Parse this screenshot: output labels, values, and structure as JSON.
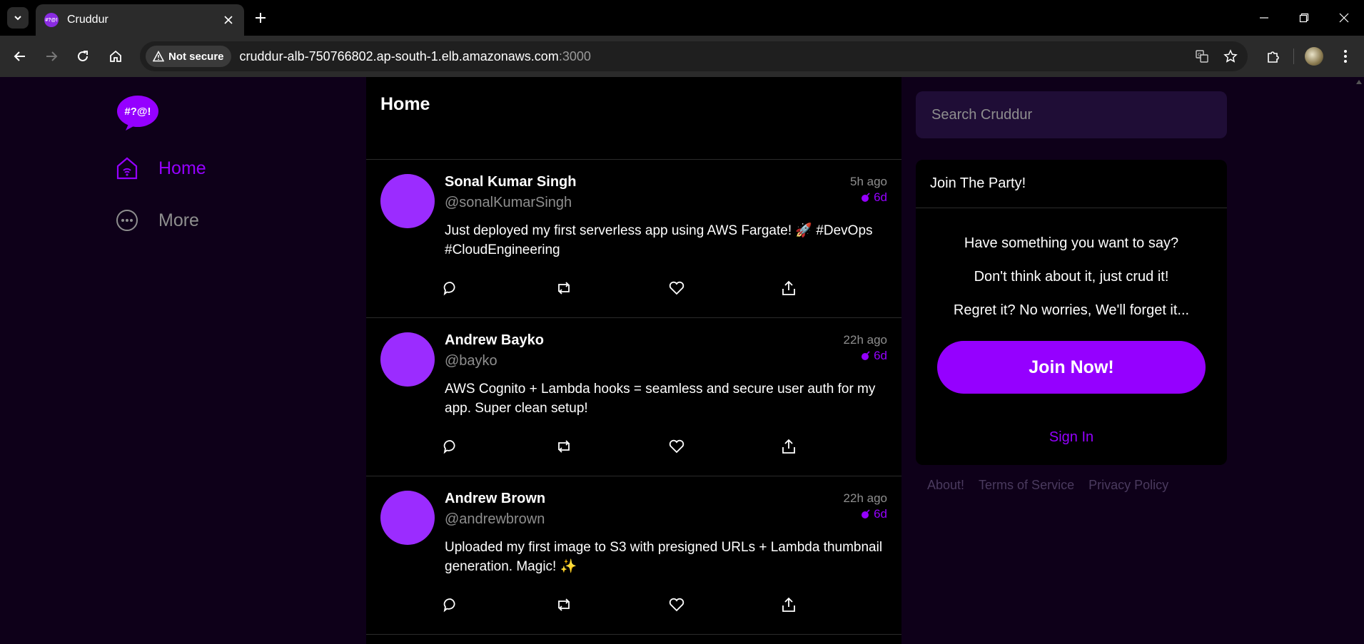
{
  "browser": {
    "tab_title": "Cruddur",
    "favicon_text": "#?@!",
    "security_label": "Not secure",
    "url_host": "cruddur-alb-750766802.ap-south-1.elb.amazonaws.com",
    "url_port": ":3000"
  },
  "app": {
    "logo_text": "#?@!",
    "accent_color": "#9500ff",
    "nav": [
      {
        "label": "Home",
        "icon": "home-icon",
        "active": true
      },
      {
        "label": "More",
        "icon": "more-icon",
        "active": false
      }
    ]
  },
  "feed": {
    "title": "Home",
    "posts": [
      {
        "display_name": "Sonal Kumar Singh",
        "handle": "@sonalKumarSingh",
        "created": "5h ago",
        "expires": "6d",
        "message": "Just deployed my first serverless app using AWS Fargate! 🚀 #DevOps #CloudEngineering"
      },
      {
        "display_name": "Andrew Bayko",
        "handle": "@bayko",
        "created": "22h ago",
        "expires": "6d",
        "message": "AWS Cognito + Lambda hooks = seamless and secure user auth for my app. Super clean setup!"
      },
      {
        "display_name": "Andrew Brown",
        "handle": "@andrewbrown",
        "created": "22h ago",
        "expires": "6d",
        "message": "Uploaded my first image to S3 with presigned URLs + Lambda thumbnail generation. Magic! ✨"
      }
    ]
  },
  "sidebar": {
    "search_placeholder": "Search Cruddur",
    "join": {
      "title": "Join The Party!",
      "line1": "Have something you want to say?",
      "line2": "Don't think about it, just crud it!",
      "line3": "Regret it? No worries, We'll forget it...",
      "button": "Join Now!",
      "sign_in": "Sign In"
    },
    "footer": [
      "About!",
      "Terms of Service",
      "Privacy Policy"
    ]
  }
}
